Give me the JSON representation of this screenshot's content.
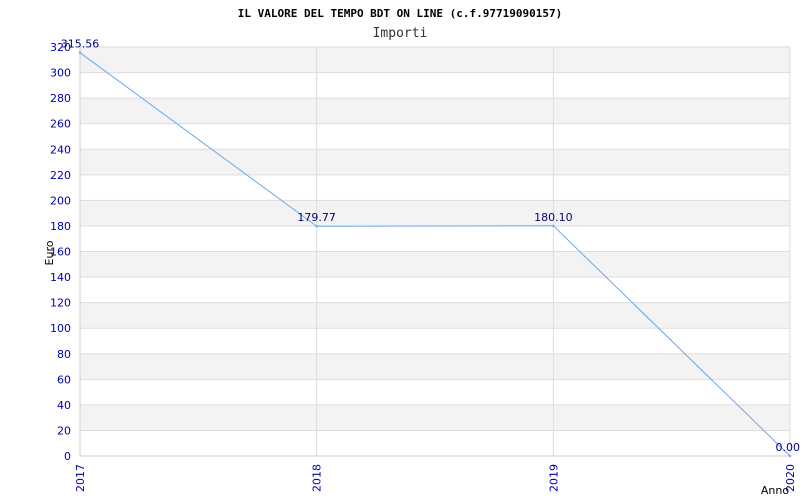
{
  "chart_data": {
    "type": "line",
    "title": "IL VALORE DEL TEMPO BDT ON LINE (c.f.97719090157)",
    "subtitle": "Importi",
    "xlabel": "Anno",
    "ylabel": "Euro",
    "categories": [
      "2017",
      "2018",
      "2019",
      "2020"
    ],
    "series": [
      {
        "values": [
          315.56,
          179.77,
          180.1,
          0.0
        ]
      }
    ],
    "data_labels": [
      "315.56",
      "179.77",
      "180.10",
      "0.00"
    ],
    "ylim": [
      0,
      320
    ],
    "yticks": [
      0,
      20,
      40,
      60,
      80,
      100,
      120,
      140,
      160,
      180,
      200,
      220,
      240,
      260,
      280,
      300,
      320
    ],
    "grid": true,
    "colors": {
      "line": "#6aa8e8",
      "band": "#f3f3f3",
      "tick_text": "#0000aa"
    }
  }
}
